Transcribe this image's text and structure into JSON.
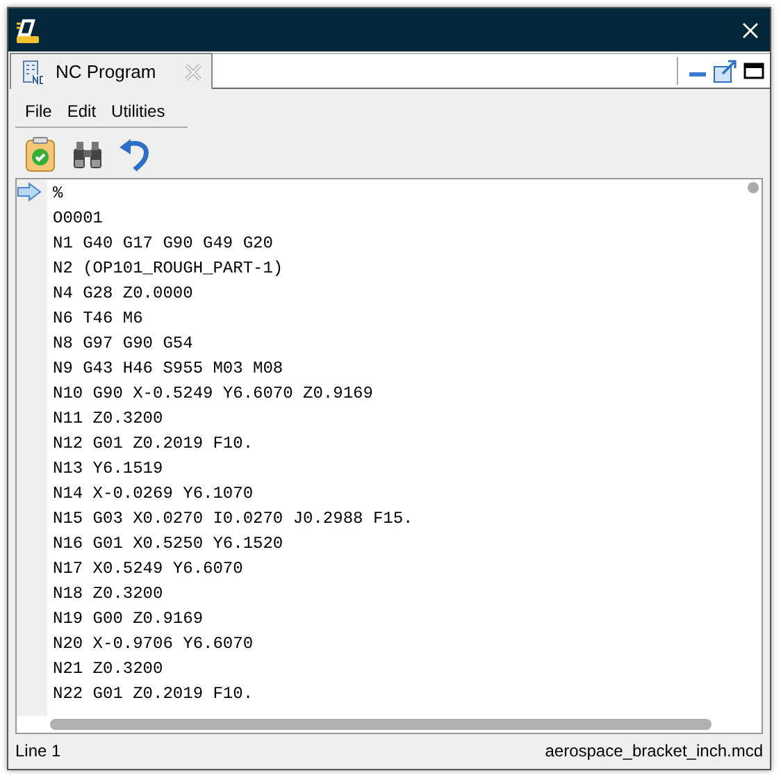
{
  "tab": {
    "label": "NC Program"
  },
  "menu": [
    "File",
    "Edit",
    "Utilities"
  ],
  "editor": {
    "lines": [
      "%",
      "O0001",
      "N1 G40 G17 G90 G49 G20",
      "N2 (OP101_ROUGH_PART-1)",
      "N4 G28 Z0.0000",
      "N6 T46 M6",
      "N8 G97 G90 G54",
      "N9 G43 H46 S955 M03 M08",
      "N10 G90 X-0.5249 Y6.6070 Z0.9169",
      "N11 Z0.3200",
      "N12 G01 Z0.2019 F10.",
      "N13 Y6.1519",
      "N14 X-0.0269 Y6.1070",
      "N15 G03 X0.0270 I0.0270 J0.2988 F15.",
      "N16 G01 X0.5250 Y6.1520",
      "N17 X0.5249 Y6.6070",
      "N18 Z0.3200",
      "N19 G00 Z0.9169",
      "N20 X-0.9706 Y6.6070",
      "N21 Z0.3200",
      "N22 G01 Z0.2019 F10."
    ]
  },
  "status_bar": {
    "position": "Line 1",
    "file": "aerospace_bracket_inch.mcd"
  }
}
